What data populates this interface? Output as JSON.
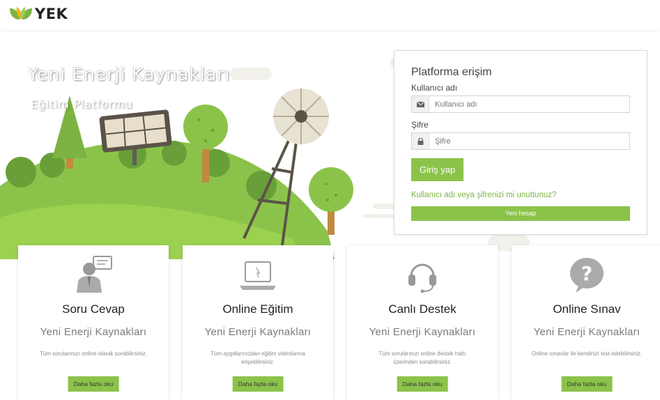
{
  "brand": {
    "name": "YEK",
    "accent": "#8bc34a",
    "accent_dark": "#6aa83a",
    "logo_icon": "leaves-icon"
  },
  "hero": {
    "title": "Yeni Enerji Kaynakları",
    "subtitle": "Eğitim Platformu"
  },
  "login": {
    "title": "Platforma erişim",
    "username_label": "Kullanıcı adı",
    "username_placeholder": "Kullanıcı adı",
    "username_icon": "envelope-icon",
    "password_label": "Şifre",
    "password_placeholder": "Şifre",
    "password_icon": "lock-icon",
    "submit_label": "Giriş yap",
    "forgot_label": "Kullanıcı adı veya şifrenizi mi unuttunuz?",
    "new_account_label": "Yeni hesap"
  },
  "features": [
    {
      "icon": "support-person-icon",
      "title": "Soru Cevap",
      "subtitle": "Yeni Enerji Kaynakları",
      "description": "Tüm sorularınızı online olarak sorabilirsiniz.",
      "button": "Daha fazla oku"
    },
    {
      "icon": "laptop-icon",
      "title": "Online Eğitim",
      "subtitle": "Yeni Enerji Kaynakları",
      "description": "Tüm aygıtlarınızdan eğitim videolarına erişebilirsiniz.",
      "button": "Daha fazla oku"
    },
    {
      "icon": "headset-icon",
      "title": "Canlı Destek",
      "subtitle": "Yeni Enerji Kaynakları",
      "description": "Tüm sorularınızı online destek hattı üzerinden sorabilirsiniz.",
      "button": "Daha fazla oku"
    },
    {
      "icon": "question-bubble-icon",
      "title": "Online Sınav",
      "subtitle": "Yeni Enerji Kaynakları",
      "description": "Online sınavlar ile kendinizi test edebilirsiniz.",
      "button": "Daha fazla oku"
    }
  ]
}
